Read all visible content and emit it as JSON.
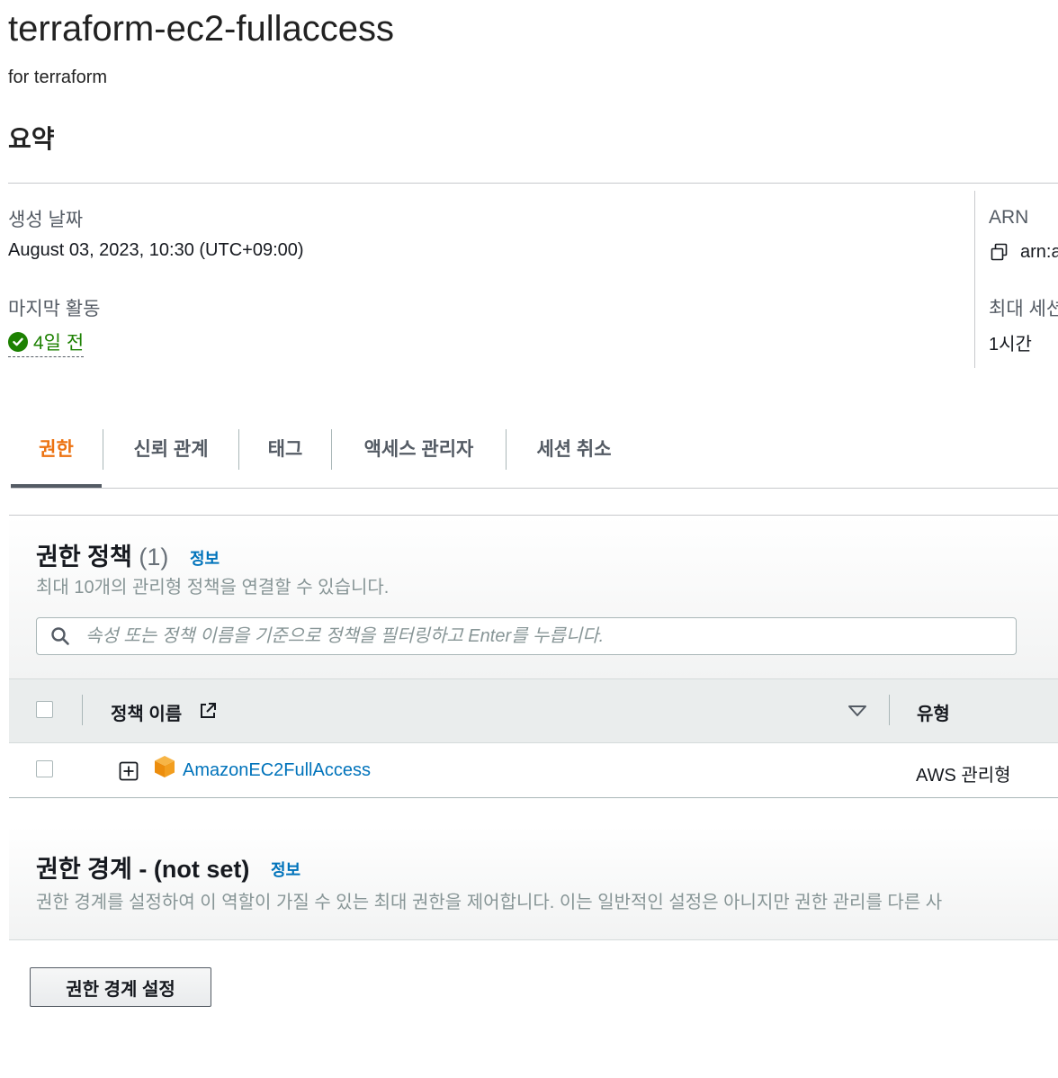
{
  "role": {
    "name": "terraform-ec2-fullaccess",
    "description": "for terraform"
  },
  "summary": {
    "heading": "요약",
    "created_label": "생성 날짜",
    "created_value": "August 03, 2023, 10:30 (UTC+09:00)",
    "last_activity_label": "마지막 활동",
    "last_activity_value": "4일 전",
    "arn_label": "ARN",
    "arn_value": "arn:a",
    "max_session_label": "최대 세션",
    "max_session_value": "1시간"
  },
  "tabs": [
    {
      "label": "권한",
      "active": true
    },
    {
      "label": "신뢰 관계"
    },
    {
      "label": "태그"
    },
    {
      "label": "액세스 관리자"
    },
    {
      "label": "세션 취소"
    }
  ],
  "permissions": {
    "title": "권한 정책",
    "count": "(1)",
    "info": "정보",
    "subtitle": "최대 10개의 관리형 정책을 연결할 수 있습니다.",
    "search_placeholder": "속성 또는 정책 이름을 기준으로 정책을 필터링하고 Enter를 누릅니다.",
    "columns": {
      "name": "정책 이름",
      "type": "유형"
    },
    "rows": [
      {
        "name": "AmazonEC2FullAccess",
        "type": "AWS 관리형"
      }
    ]
  },
  "boundary": {
    "title": "권한 경계 - (not set)",
    "info": "정보",
    "description": "권한 경계를 설정하여 이 역할이 가질 수 있는 최대 권한을 제어합니다. 이는 일반적인 설정은 아니지만 권한 관리를 다른 사",
    "button_label": "권한 경계 설정"
  },
  "colors": {
    "accent": "#ec7211",
    "link": "#0073bb",
    "success": "#1d8102"
  }
}
